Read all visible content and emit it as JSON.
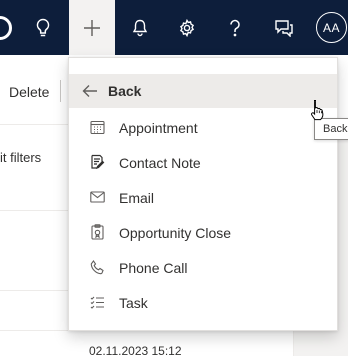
{
  "topnav": {
    "avatar_initials": "AA",
    "icons": [
      "app-logo-icon",
      "lightbulb-icon",
      "plus-icon",
      "bell-icon",
      "gear-icon",
      "help-icon",
      "chat-icon"
    ]
  },
  "background": {
    "delete_label": "Delete",
    "filters_label": "it filters",
    "date_text": "02.11.2023 15:12"
  },
  "menu": {
    "back_label": "Back",
    "items": [
      {
        "label": "Appointment",
        "icon": "calendar-icon"
      },
      {
        "label": "Contact Note",
        "icon": "note-edit-icon"
      },
      {
        "label": "Email",
        "icon": "mail-icon"
      },
      {
        "label": "Opportunity Close",
        "icon": "clipboard-icon"
      },
      {
        "label": "Phone Call",
        "icon": "phone-icon"
      },
      {
        "label": "Task",
        "icon": "task-list-icon"
      }
    ]
  },
  "tooltip": {
    "text": "Back"
  },
  "colors": {
    "nav_bg": "#0d1e3b",
    "menu_hover": "#edebe9",
    "text": "#323130"
  }
}
